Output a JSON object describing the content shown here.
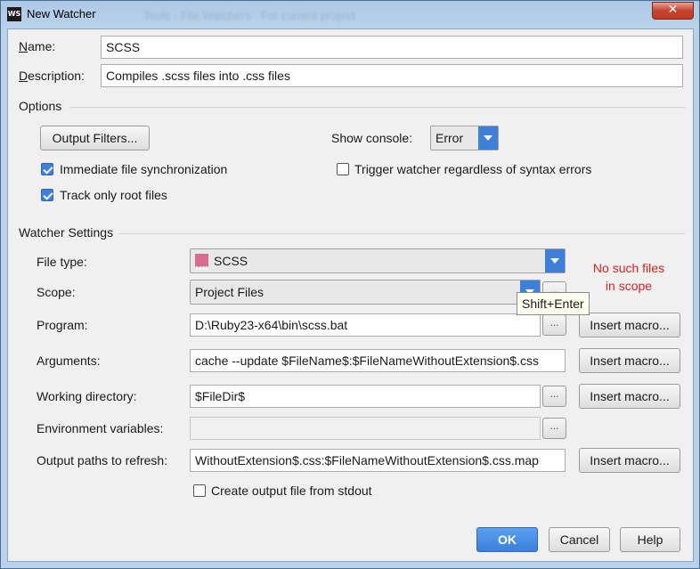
{
  "window": {
    "title": "New Watcher",
    "app_icon": "WS",
    "background_title": "Tools - File Watchers",
    "background_subtitle": "For current project",
    "close_glyph": "✕"
  },
  "form": {
    "name_label": "Name:",
    "name_value": "SCSS",
    "description_label": "Description:",
    "description_value": "Compiles .scss files into .css files"
  },
  "options": {
    "section_title": "Options",
    "output_filters_button": "Output Filters...",
    "show_console_label": "Show console:",
    "show_console_value": "Error",
    "immediate_sync_label": "Immediate file synchronization",
    "immediate_sync_checked": true,
    "trigger_regardless_label": "Trigger watcher regardless of syntax errors",
    "trigger_regardless_checked": false,
    "track_root_label": "Track only root files",
    "track_root_checked": true
  },
  "watcher": {
    "section_title": "Watcher Settings",
    "file_type_label": "File type:",
    "file_type_value": "SCSS",
    "file_type_icon": "sass-file-icon",
    "scope_label": "Scope:",
    "scope_value": "Project Files",
    "scope_warning_line1": "No such files",
    "scope_warning_line2": "in scope",
    "program_label": "Program:",
    "program_value": "D:\\Ruby23-x64\\bin\\scss.bat",
    "arguments_label": "Arguments:",
    "arguments_value": "cache --update $FileName$:$FileNameWithoutExtension$.css",
    "working_dir_label": "Working directory:",
    "working_dir_value": "$FileDir$",
    "env_vars_label": "Environment variables:",
    "env_vars_value": "",
    "output_paths_label": "Output paths to refresh:",
    "output_paths_value": "WithoutExtension$.css:$FileNameWithoutExtension$.css.map",
    "create_output_label": "Create output file from stdout",
    "create_output_checked": false,
    "insert_macro_button": "Insert macro...",
    "browse_button": "...",
    "tooltip": "Shift+Enter"
  },
  "footer": {
    "ok_button": "OK",
    "cancel_button": "Cancel",
    "help_button": "Help"
  },
  "colors": {
    "accent": "#3d7fd9",
    "warning": "#e02020",
    "titlebar": "#b9d1ea",
    "close_button": "#c7432e"
  }
}
